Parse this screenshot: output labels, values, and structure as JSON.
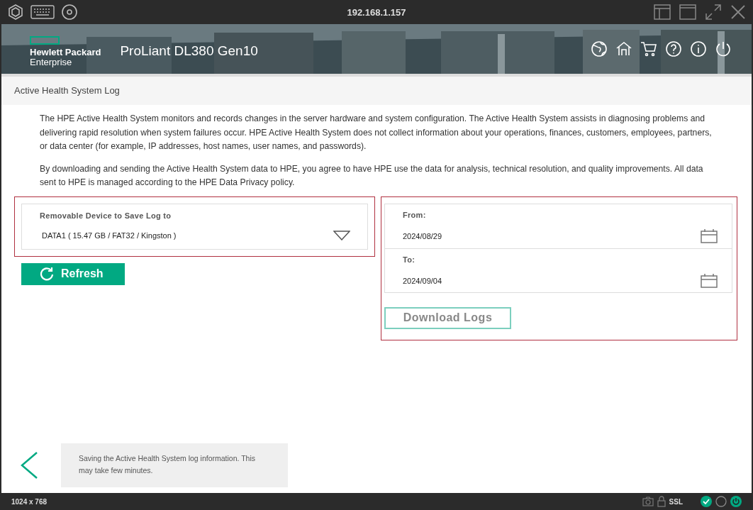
{
  "titlebar": {
    "title": "192.168.1.157"
  },
  "header": {
    "brand_line_1": "Hewlett Packard",
    "brand_line_2": "Enterprise",
    "product": "ProLiant DL380 Gen10"
  },
  "page": {
    "title": "Active Health System Log",
    "paragraphs": [
      "The HPE Active Health System monitors and records changes in the server hardware and system configuration. The Active Health System assists in diagnosing problems and delivering rapid resolution when system failures occur. HPE Active Health System does not collect information about your operations, finances, customers, employees, partners, or data center (for example, IP addresses, host names, user names, and passwords).",
      "By downloading and sending the Active Health System data to HPE, you agree to have HPE use the data for analysis, technical resolution, and quality improvements. All data sent to HPE is managed according to the HPE Data Privacy policy."
    ],
    "device": {
      "label": "Removable Device to Save Log to",
      "value": "DATA1 ( 15.47 GB / FAT32 / Kingston )"
    },
    "refresh_button": "Refresh",
    "dates": [
      {
        "label": "From:",
        "value": "2024/08/29"
      },
      {
        "label": "To:",
        "value": "2024/09/04"
      }
    ],
    "download_button": "Download Logs",
    "status_message": "Saving the Active Health System log information. This may take few minutes."
  },
  "status_bar": {
    "resolution": "1024 x 768",
    "security": "SSL"
  }
}
